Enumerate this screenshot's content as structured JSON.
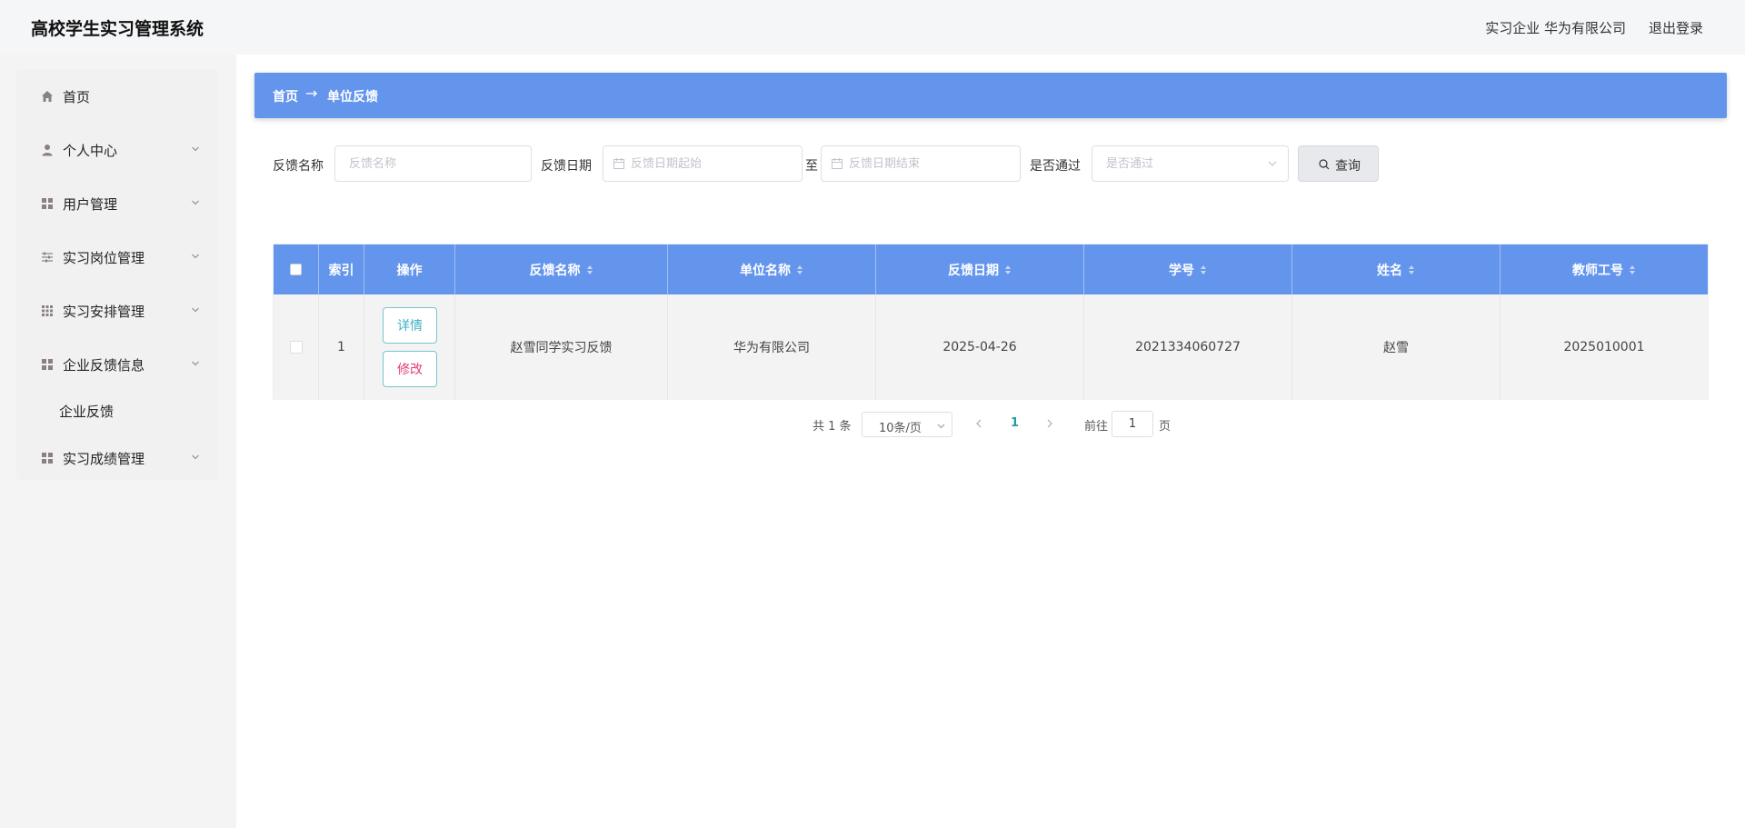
{
  "header": {
    "app_title": "高校学生实习管理系统",
    "user_info": "实习企业 华为有限公司",
    "logout": "退出登录"
  },
  "sidebar": {
    "items": [
      {
        "label": "首页",
        "icon": "home-icon"
      },
      {
        "label": "个人中心",
        "icon": "user-icon"
      },
      {
        "label": "用户管理",
        "icon": "grid-icon"
      },
      {
        "label": "实习岗位管理",
        "icon": "sliders-icon"
      },
      {
        "label": "实习安排管理",
        "icon": "grid-dots-icon"
      },
      {
        "label": "企业反馈信息",
        "icon": "grid-icon"
      },
      {
        "label": "实习成绩管理",
        "icon": "grid-icon"
      }
    ],
    "submenu": {
      "label": "企业反馈"
    }
  },
  "breadcrumb": {
    "home": "首页",
    "current": "单位反馈"
  },
  "search": {
    "name_label": "反馈名称",
    "name_placeholder": "反馈名称",
    "date_label": "反馈日期",
    "date_start_placeholder": "反馈日期起始",
    "date_to": "至",
    "date_end_placeholder": "反馈日期结束",
    "pass_label": "是否通过",
    "pass_placeholder": "是否通过",
    "query_button": "查询"
  },
  "table": {
    "headers": {
      "index": "索引",
      "operation": "操作",
      "feedback_name": "反馈名称",
      "company_name": "单位名称",
      "feedback_date": "反馈日期",
      "student_no": "学号",
      "name": "姓名",
      "teacher_no": "教师工号"
    },
    "rows": [
      {
        "index": "1",
        "detail_button": "详情",
        "edit_button": "修改",
        "feedback_name": "赵雪同学实习反馈",
        "company_name": "华为有限公司",
        "feedback_date": "2025-04-26",
        "student_no": "2021334060727",
        "name": "赵雪",
        "teacher_no": "2025010001"
      }
    ]
  },
  "pagination": {
    "total": "共 1 条",
    "page_size": "10条/页",
    "current_page": "1",
    "goto_label": "前往",
    "goto_value": "1",
    "page_suffix": "页"
  },
  "colors": {
    "accent": "#6495ed",
    "detail": "#3fb0c0",
    "edit": "#e23c7c",
    "page_active": "#20a0a0"
  }
}
